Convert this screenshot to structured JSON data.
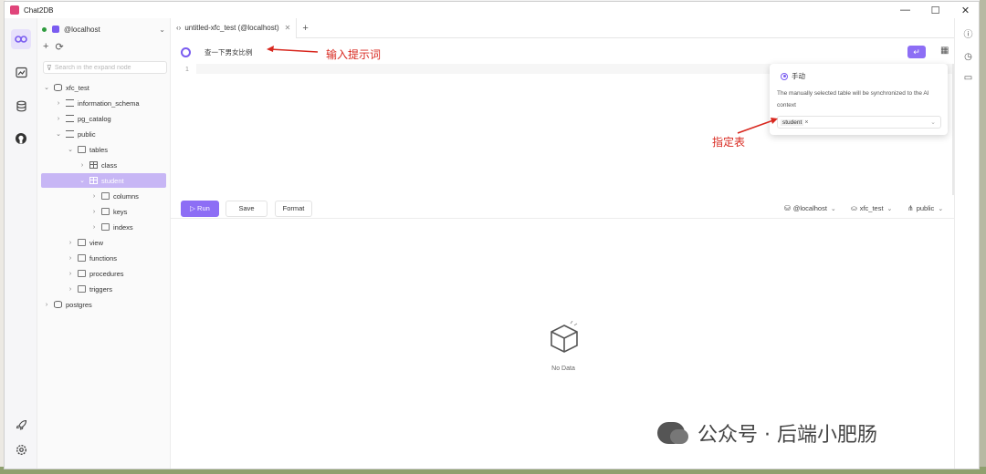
{
  "window": {
    "title": "Chat2DB",
    "controls": [
      "—",
      "☐",
      "✕"
    ]
  },
  "activity_bar": {
    "items": [
      "connections-icon",
      "dashboard-icon",
      "database-icon",
      "github-icon"
    ],
    "bottom": [
      "rocket-icon",
      "settings-icon"
    ]
  },
  "sidebar": {
    "connection": "@localhost",
    "search_placeholder": "Search in the expand node",
    "tree": [
      {
        "label": "xfc_test",
        "type": "database",
        "depth": 0,
        "expanded": true
      },
      {
        "label": "information_schema",
        "type": "schema",
        "depth": 1,
        "expanded": false
      },
      {
        "label": "pg_catalog",
        "type": "schema",
        "depth": 1,
        "expanded": false
      },
      {
        "label": "public",
        "type": "schema",
        "depth": 1,
        "expanded": true
      },
      {
        "label": "tables",
        "type": "folder",
        "depth": 2,
        "expanded": true
      },
      {
        "label": "class",
        "type": "table",
        "depth": 3,
        "expanded": false
      },
      {
        "label": "student",
        "type": "table",
        "depth": 3,
        "expanded": true,
        "selected": true
      },
      {
        "label": "columns",
        "type": "folder",
        "depth": 4,
        "expanded": false
      },
      {
        "label": "keys",
        "type": "folder",
        "depth": 4,
        "expanded": false
      },
      {
        "label": "indexs",
        "type": "folder",
        "depth": 4,
        "expanded": false
      },
      {
        "label": "view",
        "type": "folder",
        "depth": 2,
        "expanded": false
      },
      {
        "label": "functions",
        "type": "folder",
        "depth": 2,
        "expanded": false
      },
      {
        "label": "procedures",
        "type": "folder",
        "depth": 2,
        "expanded": false
      },
      {
        "label": "triggers",
        "type": "folder",
        "depth": 2,
        "expanded": false
      },
      {
        "label": "postgres",
        "type": "database",
        "depth": 0,
        "expanded": false
      }
    ]
  },
  "tabs": [
    {
      "label": "untitled-xfc_test (@localhost)",
      "active": true
    }
  ],
  "ai_prompt": {
    "value": "查一下男女比例"
  },
  "editor": {
    "line_numbers": [
      "1"
    ]
  },
  "popover": {
    "radio_label": "手动",
    "description": "The manually selected table will be synchronized to the AI context",
    "selected_tags": [
      "student"
    ]
  },
  "toolbar": {
    "run_label": "Run",
    "save_label": "Save",
    "format_label": "Format",
    "connection": "@localhost",
    "database": "xfc_test",
    "schema": "public"
  },
  "result": {
    "empty_text": "No Data"
  },
  "annotations": {
    "prompt_note": "输入提示词",
    "table_note": "指定表",
    "color": "#d8281f"
  },
  "watermark": {
    "text": "公众号 · 后端小肥肠"
  },
  "colors": {
    "accent": "#8d6ef5",
    "selected_row": "#c7b6f5",
    "online": "#2e9b3e"
  }
}
